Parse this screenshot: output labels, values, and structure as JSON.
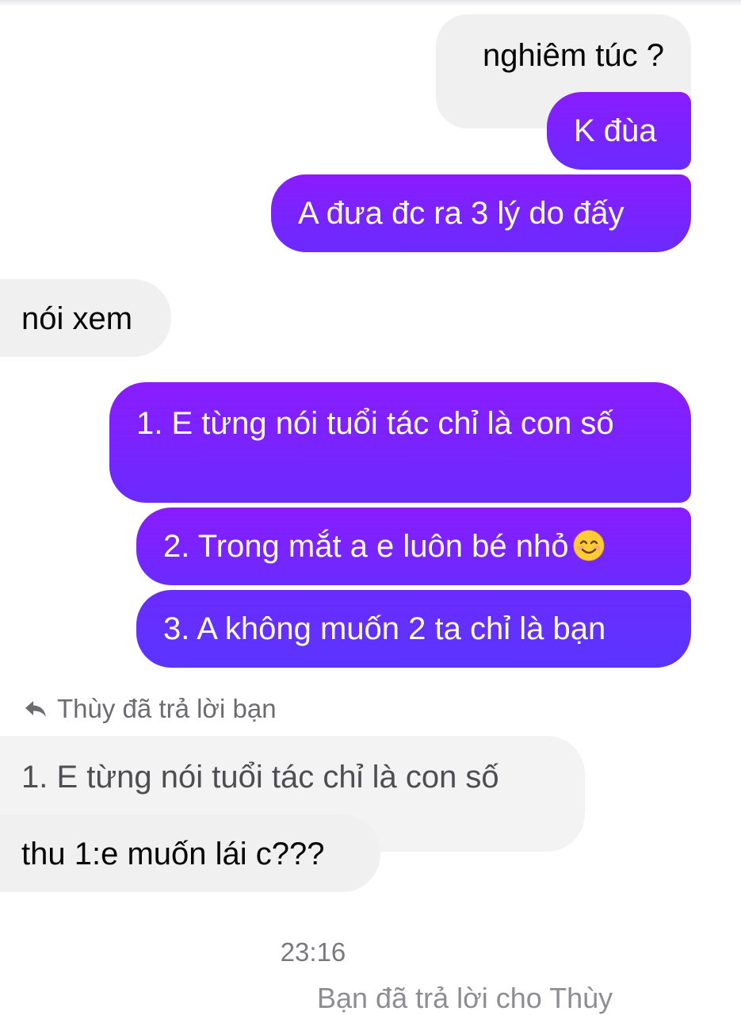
{
  "messages": {
    "nghiem_tuc": "nghiêm túc ?",
    "k_dua": "K đùa",
    "a_dua": "A đưa đc ra 3 lý do đấy",
    "noi_xem": "nói xem",
    "reason_1": "1. E từng nói tuổi tác chỉ là con số",
    "reason_2": "2. Trong mắt a e luôn bé nhỏ",
    "reason_3": "3. A không muốn 2 ta chỉ là bạn",
    "reply_header": "Thùy đã trả lời bạn",
    "quoted": "1. E từng nói tuổi tác chỉ là con số",
    "thu_1": "thu 1:e muốn lái c???"
  },
  "timestamp": "23:16",
  "cut_off_text": "Bạn đã trả lời cho Thùy",
  "icons": {
    "reply": "reply-arrow-icon",
    "emoji": "smiling-face-emoji"
  },
  "colors": {
    "outgoing": "#7a24ff",
    "incoming": "#f0f0f0",
    "text_outgoing": "#ffffff",
    "text_incoming": "#050505"
  }
}
